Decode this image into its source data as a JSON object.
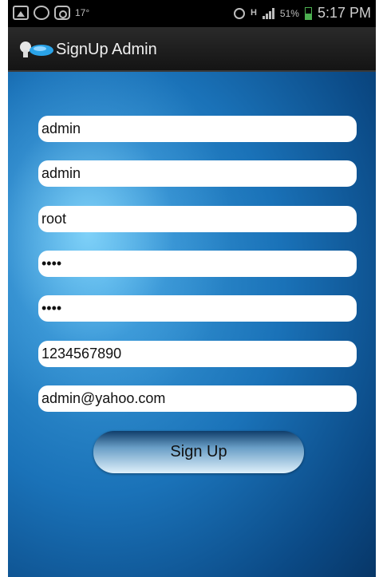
{
  "status_bar": {
    "temperature": "17°",
    "network": "H",
    "battery": "51%",
    "time": "5:17 PM"
  },
  "header": {
    "title": "SignUp Admin"
  },
  "form": {
    "first_name": "admin",
    "last_name": "admin",
    "username": "root",
    "password": "••••",
    "confirm_password": "••••",
    "phone": "1234567890",
    "email": "admin@yahoo.com",
    "signup_label": "Sign Up"
  }
}
